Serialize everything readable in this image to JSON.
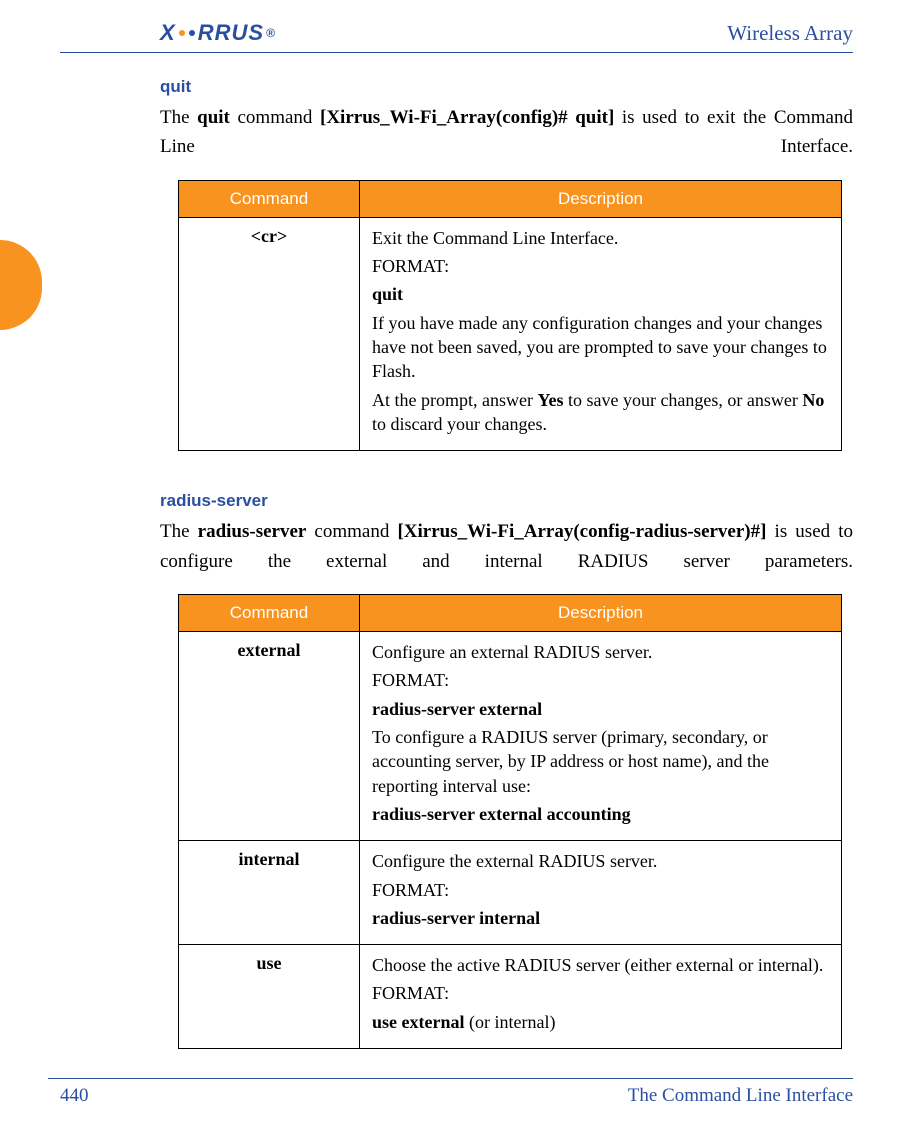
{
  "header": {
    "logo_text": "XIRRUS",
    "doc_title": "Wireless Array"
  },
  "sections": [
    {
      "heading": "quit",
      "intro_parts": [
        "The ",
        "quit",
        " command ",
        "[Xirrus_Wi-Fi_Array(config)# quit]",
        " is used to exit the Command Line Interface."
      ],
      "table": {
        "col1": "Command",
        "col2": "Description",
        "rows": [
          {
            "command": "<cr>",
            "desc_line1": "Exit the Command Line Interface.",
            "format_label": "FORMAT:",
            "format_cmd": "quit",
            "para1_a": "If you have made any configuration changes and your changes have not been saved, you are prompted to save your changes to Flash.",
            "para2_a": "At the prompt, answer ",
            "para2_b": "Yes",
            "para2_c": " to save your changes, or answer ",
            "para2_d": "No",
            "para2_e": " to discard your changes."
          }
        ]
      }
    },
    {
      "heading": "radius-server",
      "intro_parts": [
        "The ",
        "radius-server",
        " command ",
        "[Xirrus_Wi-Fi_Array(config-radius-server)#]",
        " is used to configure the external and internal RADIUS server parameters."
      ],
      "table": {
        "col1": "Command",
        "col2": "Description",
        "rows": [
          {
            "command": "external",
            "desc_line1": "Configure an external RADIUS server.",
            "format_label": "FORMAT:",
            "format_cmd": "radius-server external",
            "para1_a": "To configure a RADIUS server (primary, secondary, or accounting server, by IP address or host name), and the reporting interval use:",
            "para2_bold": "radius-server external accounting"
          },
          {
            "command": "internal",
            "desc_line1": "Configure the external RADIUS server.",
            "format_label": "FORMAT:",
            "format_cmd": "radius-server internal"
          },
          {
            "command": "use",
            "desc_line1": "Choose the active RADIUS server (either external or internal).",
            "format_label": "FORMAT:",
            "format_cmd_a": "use external",
            "format_cmd_b": " (or internal)"
          }
        ]
      }
    }
  ],
  "footer": {
    "page_number": "440",
    "section_title": "The Command Line Interface"
  }
}
